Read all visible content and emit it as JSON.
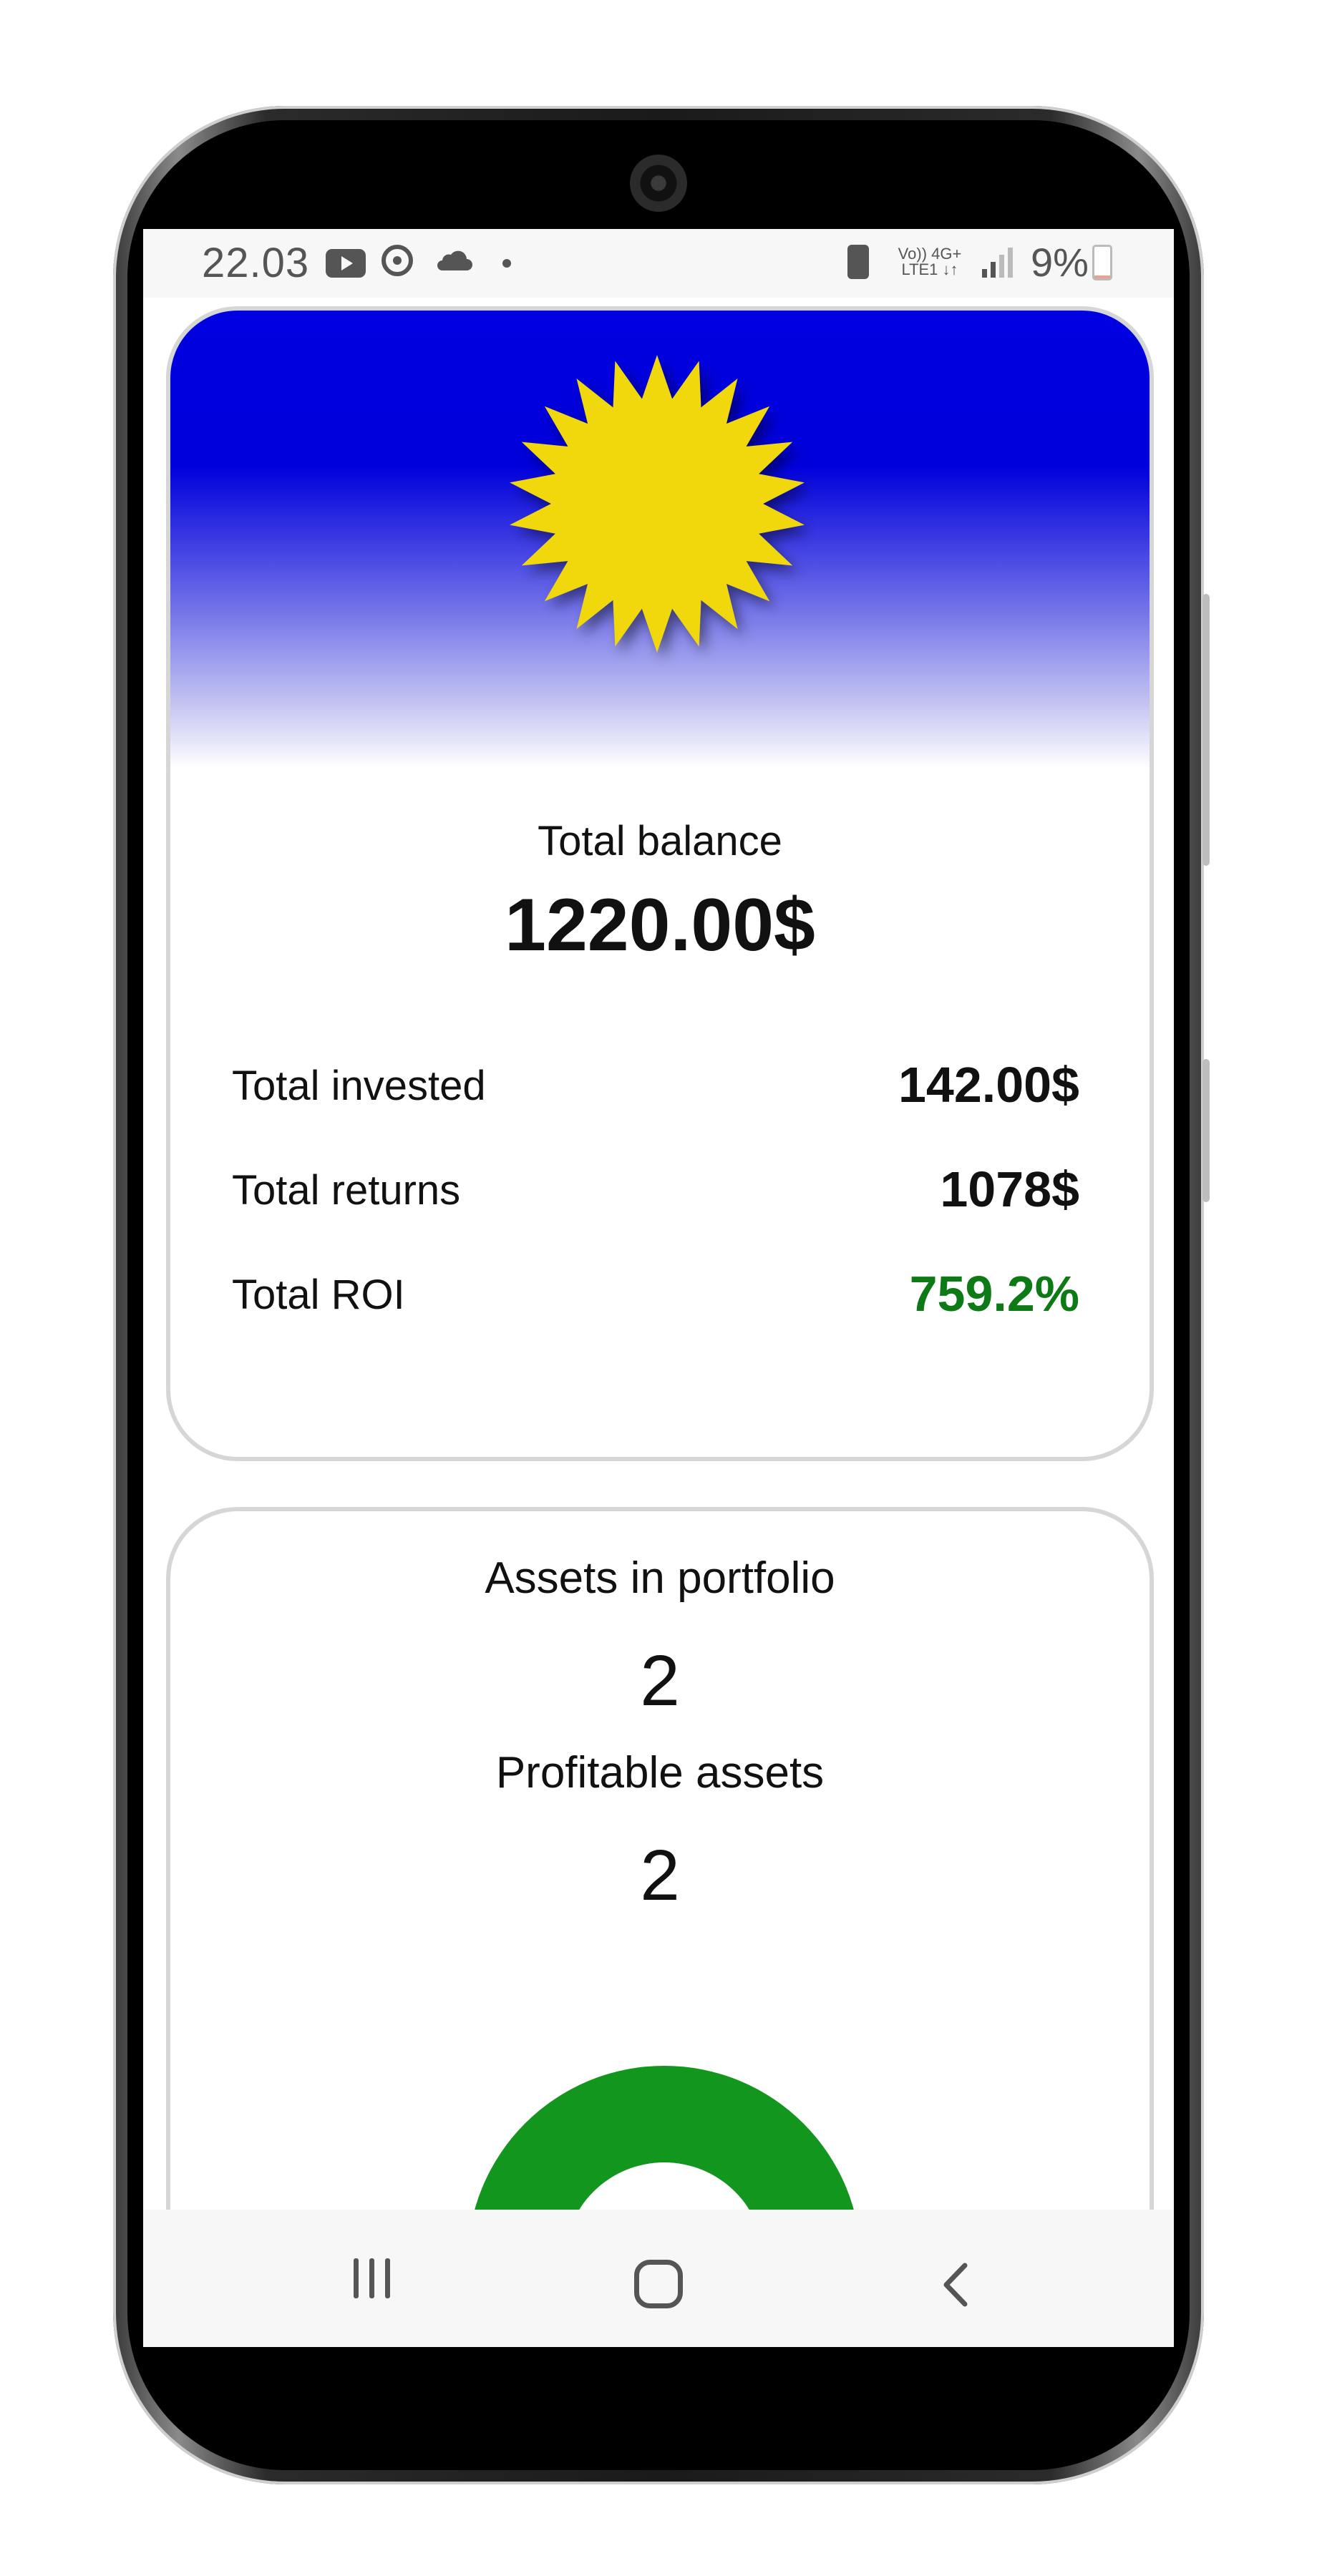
{
  "status_bar": {
    "time": "22.03",
    "network_top": "Vo)) 4G+",
    "network_bottom": "LTE1 ↓↑",
    "battery_percent_label": "9%",
    "battery_level": 0.09,
    "icons": [
      "youtube-icon",
      "sync-icon",
      "cloud-icon",
      "notification-dot-icon",
      "battery-saver-icon",
      "signal-icon",
      "battery-icon"
    ]
  },
  "balance_card": {
    "header_image": "sun-icon",
    "total_balance_label": "Total balance",
    "total_balance_value": "1220.00$",
    "rows": [
      {
        "label": "Total invested",
        "value": "142.00$",
        "color": "#111111"
      },
      {
        "label": "Total returns",
        "value": "1078$",
        "color": "#111111"
      },
      {
        "label": "Total ROI",
        "value": "759.2%",
        "color": "#0d7a16"
      }
    ]
  },
  "assets_card": {
    "assets_label": "Assets in portfolio",
    "assets_value": "2",
    "profitable_label": "Profitable assets",
    "profitable_value": "2",
    "gauge_profitable_fraction": 1.0
  },
  "nav_bar": {
    "icons": [
      "recents-icon",
      "home-icon",
      "back-icon"
    ]
  },
  "colors": {
    "header_blue": "#0000e0",
    "sun_yellow": "#f0d80c",
    "gauge_green": "#12961e",
    "roi_green": "#0d7a16",
    "card_border": "#d6d6d6"
  }
}
